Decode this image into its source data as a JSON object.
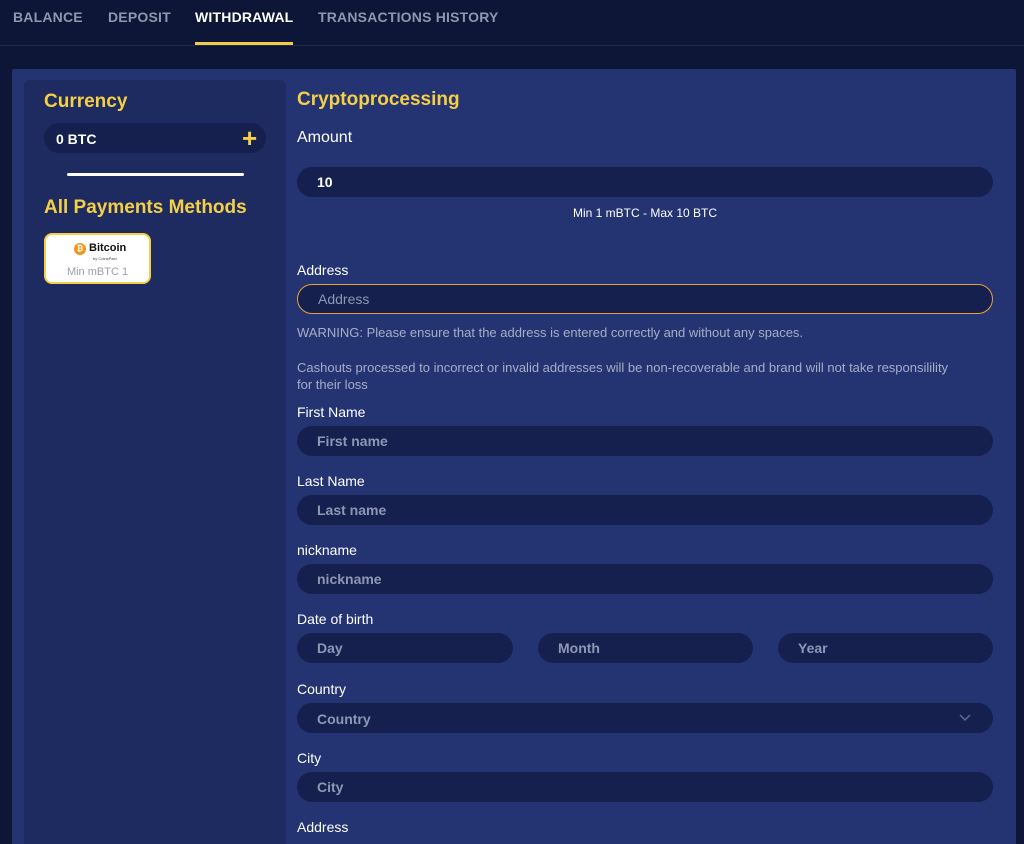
{
  "tabs": [
    {
      "label": "BALANCE"
    },
    {
      "label": "DEPOSIT"
    },
    {
      "label": "WITHDRAWAL"
    },
    {
      "label": "TRANSACTIONS HISTORY"
    }
  ],
  "sidebar": {
    "currency_title": "Currency",
    "currency_value": "0 BTC",
    "methods_title": "All Payments Methods",
    "method": {
      "name": "Bitcoin",
      "provider": "by CoinsPaid",
      "min": "Min mBTC 1"
    }
  },
  "form": {
    "title": "Cryptoprocessing",
    "amount_label": "Amount",
    "amount_value": "10",
    "amount_hint": "Min 1 mBTC - Max 10 BTC",
    "address_label": "Address",
    "address_placeholder": "Address",
    "warning": "WARNING: Please ensure that the address is entered correctly and without any spaces.",
    "cashout_note": "Cashouts processed to incorrect or invalid addresses will be non-recoverable and brand will not take responsilility for their loss",
    "first_name_label": "First Name",
    "first_name_placeholder": "First name",
    "last_name_label": "Last Name",
    "last_name_placeholder": "Last name",
    "nickname_label": "nickname",
    "nickname_placeholder": "nickname",
    "dob_label": "Date of birth",
    "day_placeholder": "Day",
    "month_placeholder": "Month",
    "year_placeholder": "Year",
    "country_label": "Country",
    "country_placeholder": "Country",
    "city_label": "City",
    "city_placeholder": "City",
    "address2_label": "Address"
  },
  "colors": {
    "accent": "#f5cf46",
    "panel": "#243472",
    "field": "#15204e",
    "focus_border": "#e8a23a"
  }
}
